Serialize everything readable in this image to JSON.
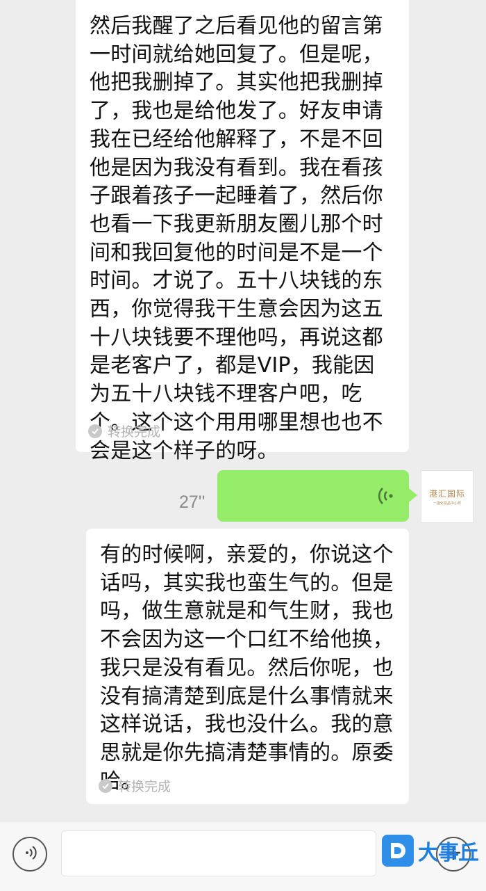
{
  "messages": [
    {
      "text": "然后我醒了之后看见他的留言第一时间就给她回复了。但是呢，他把我删掉了。其实他把我删掉了，我也是给他发了。好友申请我在已经给他解释了，不是不回他是因为我没有看到。我在看孩子跟着孩子一起睡着了，然后你也看一下我更新朋友圈儿那个时间和我回复他的时间是不是一个时间。才说了。五十八块钱的东西，你觉得我干生意会因为这五十八块钱要不理他吗，再说这都是老客户了，都是VIP，我能因为五十八块钱不理客户吧，吃个。这个这个用用哪里想也也不会是这个样子的呀。",
      "status": "转换完成"
    },
    {
      "duration": "27''"
    },
    {
      "text": "有的时候啊，亲爱的，你说这个话吗，其实我也蛮生气的。但是吗，做生意就是和气生财，我也不会因为这一个口红不给他换，我只是没有看见。然后你呢，也没有搞清楚到底是什么事情就来这样说话，我也没什么。我的意思就是你先搞清楚事情的。原委哈。",
      "status": "转换完成"
    }
  ],
  "avatar": {
    "name": "港汇国际",
    "subtitle": "一指化妆品中小样"
  },
  "input": {
    "value": "",
    "placeholder": ""
  },
  "icons": {
    "voice_toggle": "voice-mode-icon",
    "voice_wave": "voice-wave-icon",
    "plus": "plus-icon",
    "check": "check-circle-icon"
  },
  "watermark": {
    "text": "大事丘"
  },
  "colors": {
    "background": "#ededed",
    "sent_bubble": "#95ec69",
    "received_bubble": "#ffffff",
    "accent": "#2f8fe8"
  }
}
